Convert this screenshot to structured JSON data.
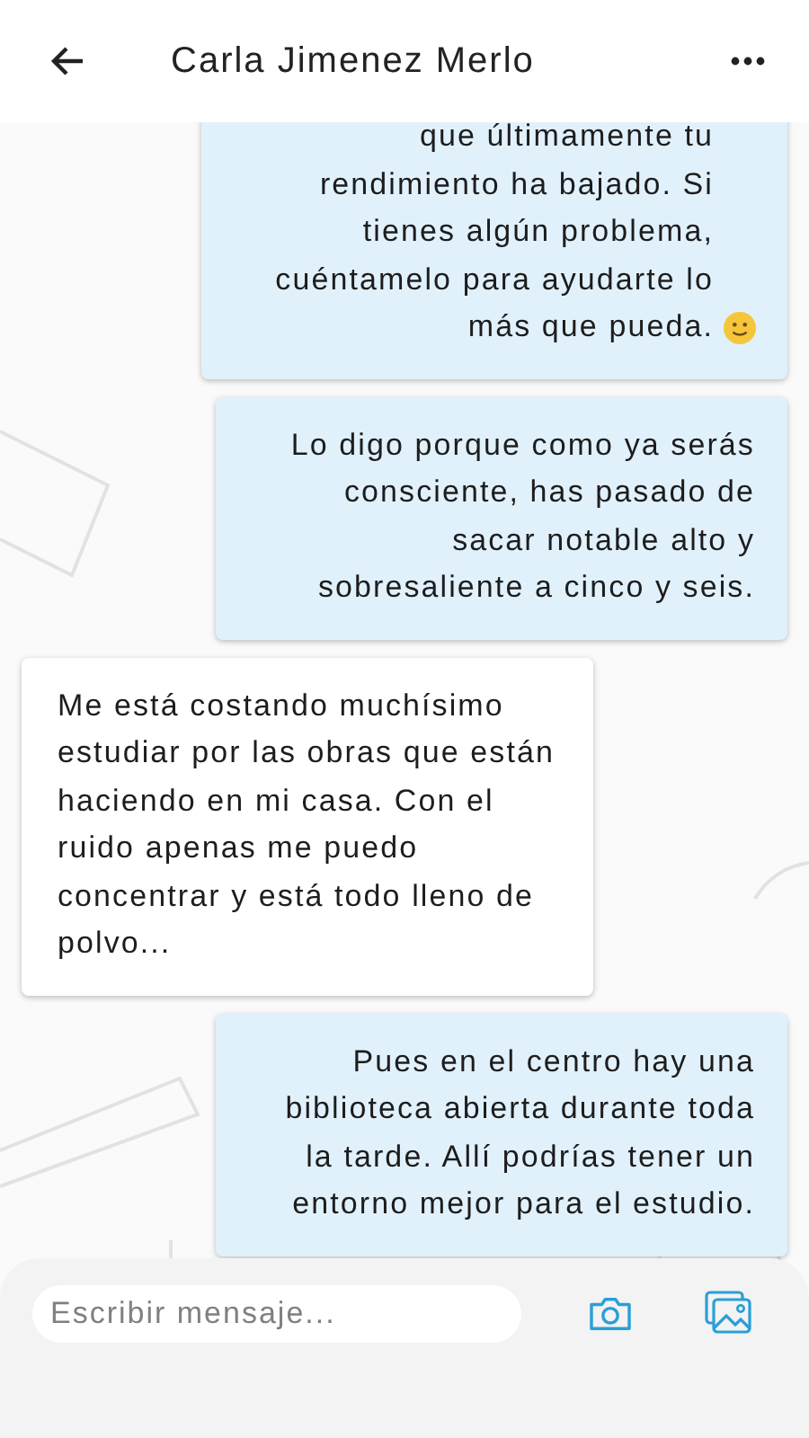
{
  "header": {
    "title": "Carla Jimenez Merlo"
  },
  "messages": [
    {
      "kind": "sent",
      "text": "que últimamente tu rendimiento ha bajado. Si tienes algún problema, cuéntamelo para ayudarte lo más que pueda.",
      "smiley": true
    },
    {
      "kind": "sent",
      "text": "Lo digo porque como ya serás consciente, has pasado de sacar notable alto y sobresaliente a cinco y seis."
    },
    {
      "kind": "received",
      "text": "Me está costando muchísimo estudiar por las obras que están haciendo en mi casa. Con el ruido apenas me puedo concentrar y está todo lleno de polvo..."
    },
    {
      "kind": "sent",
      "text": "Pues en el centro hay una biblioteca abierta durante toda la tarde. Allí podrías tener un entorno mejor para el estudio."
    }
  ],
  "composer": {
    "placeholder": "Escribir mensaje..."
  }
}
